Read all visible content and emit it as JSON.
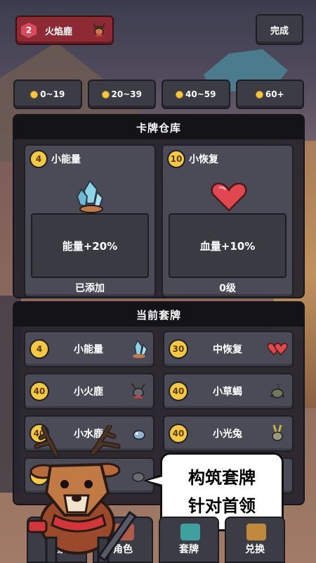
{
  "boss": {
    "level": "2",
    "name": "火焰鹿",
    "icon": "deer-boss-icon"
  },
  "top": {
    "done_label": "完成"
  },
  "filters": [
    {
      "label": "0~19"
    },
    {
      "label": "20~39"
    },
    {
      "label": "40~59"
    },
    {
      "label": "60+"
    }
  ],
  "storage": {
    "title": "卡牌仓库",
    "cards": [
      {
        "cost": "4",
        "name": "小能量",
        "desc": "能量+20%",
        "status": "已添加",
        "art": "crystal-icon"
      },
      {
        "cost": "10",
        "name": "小恢复",
        "desc": "血量+10%",
        "status": "0级",
        "art": "heart-icon"
      }
    ]
  },
  "deck": {
    "title": "当前套牌",
    "cards": [
      {
        "cost": "4",
        "name": "小能量",
        "icon": "crystal-icon"
      },
      {
        "cost": "30",
        "name": "中恢复",
        "icon": "double-heart-icon"
      },
      {
        "cost": "40",
        "name": "小火鹿",
        "icon": "fire-deer-icon"
      },
      {
        "cost": "40",
        "name": "小草蝎",
        "icon": "grass-scorpion-icon"
      },
      {
        "cost": "40",
        "name": "小水鹿",
        "icon": "water-deer-icon"
      },
      {
        "cost": "40",
        "name": "小光兔",
        "icon": "light-rabbit-icon"
      },
      {
        "cost": "40",
        "name": "",
        "icon": "creature-icon"
      },
      {
        "cost": "",
        "name": "",
        "icon": ""
      }
    ]
  },
  "bubble": {
    "line1": "构筑套牌",
    "line2": "针对首领"
  },
  "nav": [
    {
      "label": "探索",
      "color": "#6a8fb0"
    },
    {
      "label": "角色",
      "color": "#b05a4a"
    },
    {
      "label": "套牌",
      "color": "#3fa0a0"
    },
    {
      "label": "兑换",
      "color": "#c08a3a"
    }
  ],
  "colors": {
    "coin": "#f5c842",
    "boss_chip": "#8e2a33",
    "panel": "#26242c",
    "card": "#4a4b56"
  }
}
